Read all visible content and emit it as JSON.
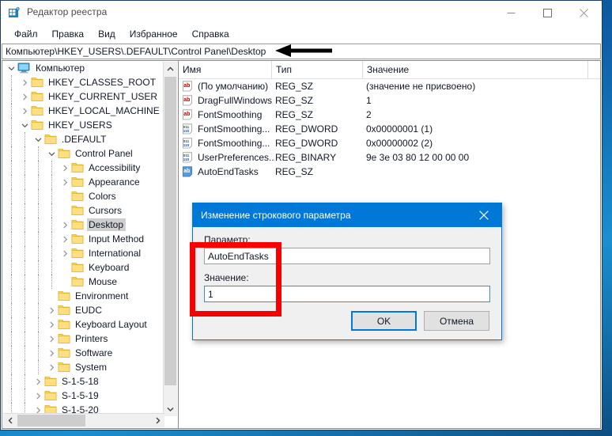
{
  "window": {
    "title": "Редактор реестра",
    "app_icon": "registry-grid-icon",
    "controls": {
      "minimize": "minimize-icon",
      "maximize": "maximize-icon",
      "close": "close-icon"
    }
  },
  "menubar": {
    "items": [
      {
        "label": "Файл"
      },
      {
        "label": "Правка"
      },
      {
        "label": "Вид"
      },
      {
        "label": "Избранное"
      },
      {
        "label": "Справка"
      }
    ]
  },
  "address": {
    "path": "Компьютер\\HKEY_USERS\\.DEFAULT\\Control Panel\\Desktop"
  },
  "annotation": {
    "arrow": "left-pointing-arrow",
    "arrow_color": "#000000",
    "highlight_box_color": "#f80000"
  },
  "tree": {
    "items": [
      {
        "label": "Компьютер",
        "indent": 0,
        "twisty": "expanded",
        "icon": "computer-icon",
        "selected": false
      },
      {
        "label": "HKEY_CLASSES_ROOT",
        "indent": 1,
        "twisty": "collapsed",
        "icon": "folder-icon",
        "selected": false
      },
      {
        "label": "HKEY_CURRENT_USER",
        "indent": 1,
        "twisty": "collapsed",
        "icon": "folder-icon",
        "selected": false
      },
      {
        "label": "HKEY_LOCAL_MACHINE",
        "indent": 1,
        "twisty": "collapsed",
        "icon": "folder-icon",
        "selected": false
      },
      {
        "label": "HKEY_USERS",
        "indent": 1,
        "twisty": "expanded",
        "icon": "folder-icon",
        "selected": false
      },
      {
        "label": ".DEFAULT",
        "indent": 2,
        "twisty": "expanded",
        "icon": "folder-icon",
        "selected": false
      },
      {
        "label": "Control Panel",
        "indent": 3,
        "twisty": "expanded",
        "icon": "folder-icon",
        "selected": false
      },
      {
        "label": "Accessibility",
        "indent": 4,
        "twisty": "collapsed",
        "icon": "folder-icon",
        "selected": false
      },
      {
        "label": "Appearance",
        "indent": 4,
        "twisty": "collapsed",
        "icon": "folder-icon",
        "selected": false
      },
      {
        "label": "Colors",
        "indent": 4,
        "twisty": "none",
        "icon": "folder-icon",
        "selected": false
      },
      {
        "label": "Cursors",
        "indent": 4,
        "twisty": "none",
        "icon": "folder-icon",
        "selected": false
      },
      {
        "label": "Desktop",
        "indent": 4,
        "twisty": "collapsed",
        "icon": "folder-icon",
        "selected": true
      },
      {
        "label": "Input Method",
        "indent": 4,
        "twisty": "collapsed",
        "icon": "folder-icon",
        "selected": false
      },
      {
        "label": "International",
        "indent": 4,
        "twisty": "collapsed",
        "icon": "folder-icon",
        "selected": false
      },
      {
        "label": "Keyboard",
        "indent": 4,
        "twisty": "none",
        "icon": "folder-icon",
        "selected": false
      },
      {
        "label": "Mouse",
        "indent": 4,
        "twisty": "none",
        "icon": "folder-icon",
        "selected": false
      },
      {
        "label": "Environment",
        "indent": 3,
        "twisty": "none",
        "icon": "folder-icon",
        "selected": false
      },
      {
        "label": "EUDC",
        "indent": 3,
        "twisty": "collapsed",
        "icon": "folder-icon",
        "selected": false
      },
      {
        "label": "Keyboard Layout",
        "indent": 3,
        "twisty": "collapsed",
        "icon": "folder-icon",
        "selected": false
      },
      {
        "label": "Printers",
        "indent": 3,
        "twisty": "collapsed",
        "icon": "folder-icon",
        "selected": false
      },
      {
        "label": "Software",
        "indent": 3,
        "twisty": "collapsed",
        "icon": "folder-icon",
        "selected": false
      },
      {
        "label": "System",
        "indent": 3,
        "twisty": "collapsed",
        "icon": "folder-icon",
        "selected": false
      },
      {
        "label": "S-1-5-18",
        "indent": 2,
        "twisty": "collapsed",
        "icon": "folder-icon",
        "selected": false
      },
      {
        "label": "S-1-5-19",
        "indent": 2,
        "twisty": "collapsed",
        "icon": "folder-icon",
        "selected": false
      },
      {
        "label": "S-1-5-20",
        "indent": 2,
        "twisty": "collapsed",
        "icon": "folder-icon",
        "selected": false
      }
    ]
  },
  "values": {
    "columns": {
      "name": "Имя",
      "type": "Тип",
      "value": "Значение"
    },
    "rows": [
      {
        "name": "(По умолчанию)",
        "type": "REG_SZ",
        "value": "(значение не присвоено)",
        "icon": "string-value-icon",
        "selected": false
      },
      {
        "name": "DragFullWindows",
        "type": "REG_SZ",
        "value": "1",
        "icon": "string-value-icon",
        "selected": false
      },
      {
        "name": "FontSmoothing",
        "type": "REG_SZ",
        "value": "2",
        "icon": "string-value-icon",
        "selected": false
      },
      {
        "name": "FontSmoothing...",
        "type": "REG_DWORD",
        "value": "0x00000001 (1)",
        "icon": "binary-value-icon",
        "selected": false
      },
      {
        "name": "FontSmoothing...",
        "type": "REG_DWORD",
        "value": "0x00000002 (2)",
        "icon": "binary-value-icon",
        "selected": false
      },
      {
        "name": "UserPreferences...",
        "type": "REG_BINARY",
        "value": "9e 3e 03 80 12 00 00 00",
        "icon": "binary-value-icon",
        "selected": false
      },
      {
        "name": "AutoEndTasks",
        "type": "REG_SZ",
        "value": "",
        "icon": "string-value-icon",
        "selected": true
      }
    ]
  },
  "dialog": {
    "title": "Изменение строкового параметра",
    "close_icon": "close-icon",
    "param_label": "Параметр:",
    "param_value": "AutoEndTasks",
    "value_label": "Значение:",
    "value_value": "1",
    "ok_label": "OK",
    "cancel_label": "Отмена",
    "accent_color": "#0078d7"
  }
}
